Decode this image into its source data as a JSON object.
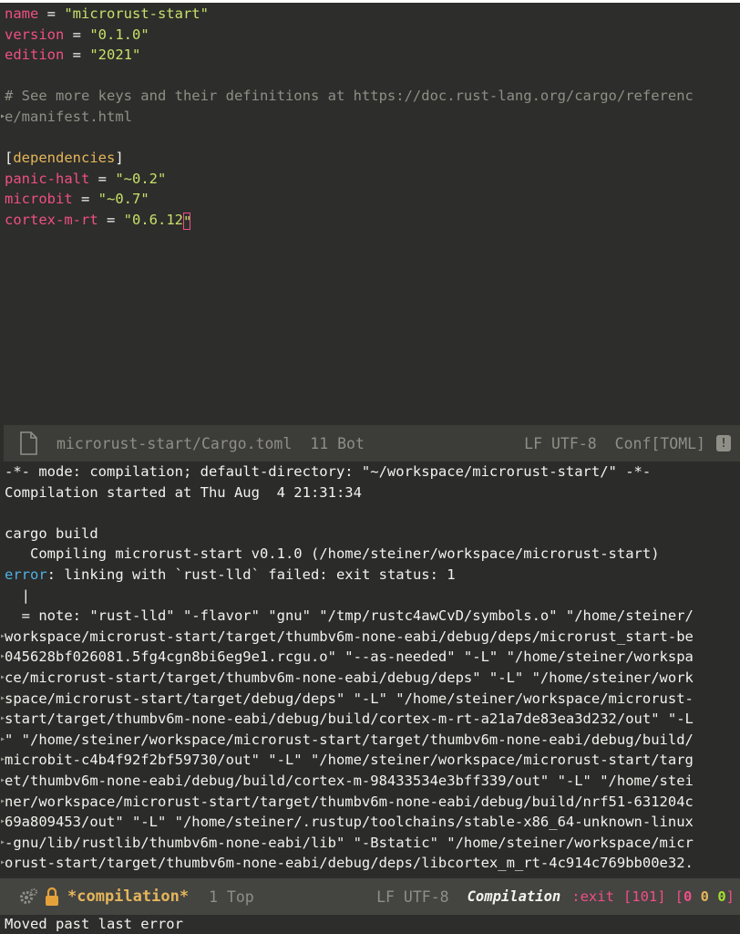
{
  "editor": {
    "lines": [
      {
        "key": "name",
        "eq": " = ",
        "val": "\"microrust-start\""
      },
      {
        "key": "version",
        "eq": " = ",
        "val": "\"0.1.0\""
      },
      {
        "key": "edition",
        "eq": " = ",
        "val": "\"2021\""
      }
    ],
    "comment_1": "# See more keys and their definitions at https://doc.rust-lang.org/cargo/referenc",
    "comment_2": "e/manifest.html",
    "section": "dependencies",
    "deps": [
      {
        "key": "panic-halt",
        "eq": " = ",
        "val": "\"~0.2\""
      },
      {
        "key": "microbit",
        "eq": " = ",
        "val": "\"~0.7\""
      },
      {
        "key": "cortex-m-rt",
        "eq": " = ",
        "val": "\"0.6.12"
      }
    ],
    "last_quote": "\""
  },
  "modeline_top": {
    "file": "microrust-start/Cargo.toml",
    "position": "11 Bot",
    "encoding": "LF UTF-8",
    "mode": "Conf[TOML]",
    "badge": "!"
  },
  "compilation": {
    "header": "-*- mode: compilation; default-directory: \"~/workspace/microrust-start/\" -*-",
    "started": "Compilation started at Thu Aug  4 21:31:34",
    "command": "cargo build",
    "compiling": "   Compiling microrust-start v0.1.0 (/home/steiner/workspace/microrust-start)",
    "error_label": "error",
    "error_text": ": linking with `rust-lld` failed: exit status: 1",
    "pipe": "  |",
    "note_lines": [
      "  = note: \"rust-lld\" \"-flavor\" \"gnu\" \"/tmp/rustc4awCvD/symbols.o\" \"/home/steiner/",
      "workspace/microrust-start/target/thumbv6m-none-eabi/debug/deps/microrust_start-be",
      "045628bf026081.5fg4cgn8bi6eg9e1.rcgu.o\" \"--as-needed\" \"-L\" \"/home/steiner/workspa",
      "ce/microrust-start/target/thumbv6m-none-eabi/debug/deps\" \"-L\" \"/home/steiner/work",
      "space/microrust-start/target/debug/deps\" \"-L\" \"/home/steiner/workspace/microrust-",
      "start/target/thumbv6m-none-eabi/debug/build/cortex-m-rt-a21a7de83ea3d232/out\" \"-L",
      "\" \"/home/steiner/workspace/microrust-start/target/thumbv6m-none-eabi/debug/build/",
      "microbit-c4b4f92f2bf59730/out\" \"-L\" \"/home/steiner/workspace/microrust-start/targ",
      "et/thumbv6m-none-eabi/debug/build/cortex-m-98433534e3bff339/out\" \"-L\" \"/home/stei",
      "ner/workspace/microrust-start/target/thumbv6m-none-eabi/debug/build/nrf51-631204c",
      "69a809453/out\" \"-L\" \"/home/steiner/.rustup/toolchains/stable-x86_64-unknown-linux",
      "-gnu/lib/rustlib/thumbv6m-none-eabi/lib\" \"-Bstatic\" \"/home/steiner/workspace/micr",
      "orust-start/target/thumbv6m-none-eabi/debug/deps/libcortex_m_rt-4c914c769bb00e32."
    ]
  },
  "modeline_bottom": {
    "buffer": "*compilation*",
    "position": "1 Top",
    "encoding": "LF UTF-8",
    "mode": "Compilation",
    "exit": ":exit",
    "exit_code": "[101]",
    "count_open": "[",
    "count_a": "0",
    "count_b": "0",
    "count_c": "0",
    "count_close": "]"
  },
  "echo_area": {
    "message": "Moved past last error"
  }
}
